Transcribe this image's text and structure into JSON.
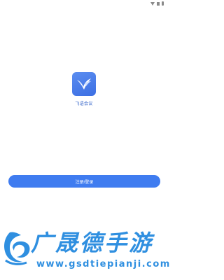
{
  "app": {
    "name": "飞语会议",
    "logo_icon": "feiyu-logo-icon",
    "brand_color": "#3f7cf0"
  },
  "actions": {
    "login_label": "注册/登录"
  },
  "watermark": {
    "title": "广晟德手游",
    "url": "www.gsdtiepianji.com",
    "color": "#2f8fe0"
  }
}
